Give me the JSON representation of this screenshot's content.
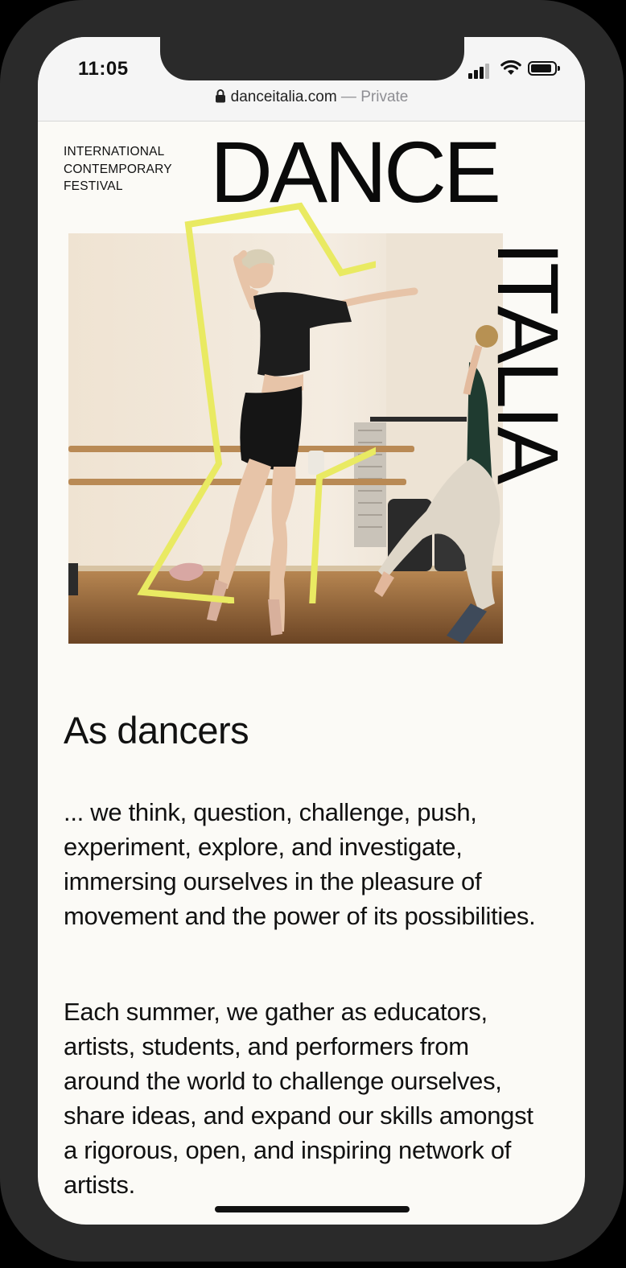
{
  "status_bar": {
    "time": "11:05",
    "icons": [
      "cellular-signal-icon",
      "wifi-icon",
      "battery-icon"
    ]
  },
  "browser": {
    "url": "danceitalia.com",
    "separator": " — ",
    "mode": "Private"
  },
  "header": {
    "festival_label": "INTERNATIONAL\nCONTEMPORARY\nFESTIVAL",
    "wordmark_top": "DANCE",
    "wordmark_side": "ITALIA"
  },
  "main": {
    "heading": "As dancers",
    "paragraphs": [
      "... we think, question, challenge, push, experiment, explore, and investigate, immersing ourselves in the pleasure of movement and the power of its possi­bilities.",
      "Each summer, we gather as educators, artists, students, and performers from around the world to challenge our­selves, share ideas, and expand our skills amongst a rigorous, open, and in­spiring network of artists."
    ]
  },
  "colors": {
    "accent_outline": "#e9ea62",
    "page_background": "#fbfaf6",
    "text": "#111111"
  }
}
